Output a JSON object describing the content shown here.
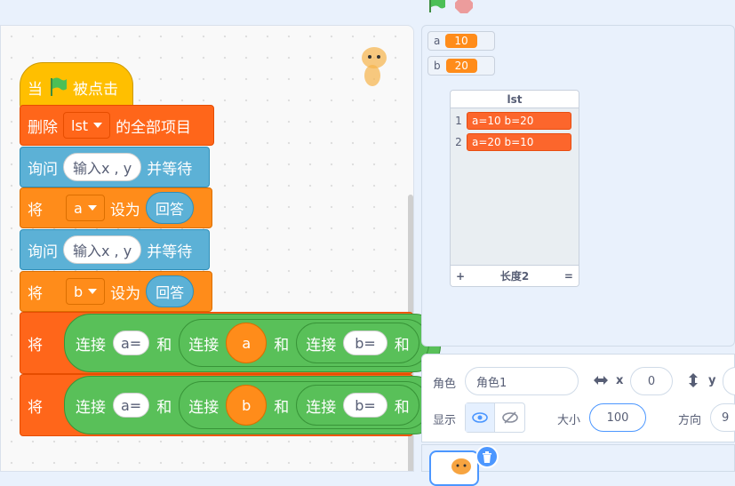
{
  "top": {
    "flag": "green-flag-icon",
    "stop": "stop-icon"
  },
  "blocks": {
    "when_flag": {
      "prefix": "当",
      "suffix": "被点击"
    },
    "delete_all": {
      "prefix": "删除",
      "list": "lst",
      "suffix": "的全部项目"
    },
    "ask1": {
      "prefix": "询问",
      "question": "输入x , y",
      "suffix": "并等待"
    },
    "set_a": {
      "prefix": "将",
      "var": "a",
      "mid": "设为",
      "value": "回答"
    },
    "ask2": {
      "prefix": "询问",
      "question": "输入x , y",
      "suffix": "并等待"
    },
    "set_b": {
      "prefix": "将",
      "var": "b",
      "mid": "设为",
      "value": "回答"
    },
    "row1": {
      "prefix": "将",
      "join1": "连接",
      "s1": "a=",
      "and1": "和",
      "join2": "连接",
      "v": "a",
      "and2": "和",
      "join3": "连接",
      "s2": "b=",
      "and3": "和"
    },
    "row2": {
      "prefix": "将",
      "join1": "连接",
      "s1": "a=",
      "and1": "和",
      "join2": "连接",
      "v": "b",
      "and2": "和",
      "join3": "连接",
      "s2": "b=",
      "and3": "和"
    }
  },
  "monitors": {
    "a": {
      "name": "a",
      "value": "10"
    },
    "b": {
      "name": "b",
      "value": "20"
    }
  },
  "list_monitor": {
    "title": "lst",
    "items": [
      {
        "index": "1",
        "value": "a=10 b=20"
      },
      {
        "index": "2",
        "value": "a=20 b=10"
      }
    ],
    "add": "+",
    "length": "长度2",
    "resize": "="
  },
  "sprite": {
    "label_sprite": "角色",
    "name": "角色1",
    "label_x": "x",
    "x": "0",
    "label_y": "y",
    "label_show": "显示",
    "label_size": "大小",
    "size": "100",
    "label_direction": "方向",
    "direction": "9"
  }
}
